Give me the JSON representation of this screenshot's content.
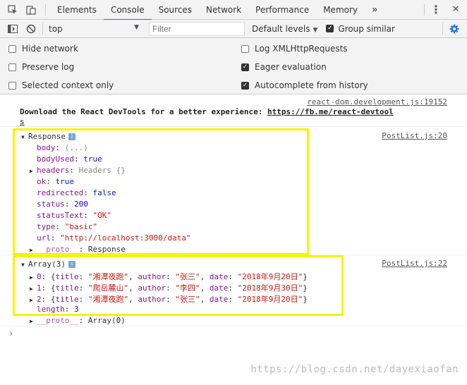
{
  "tabs": {
    "items": [
      "Elements",
      "Console",
      "Sources",
      "Network",
      "Performance",
      "Memory"
    ],
    "more": "»",
    "menu": "⋮",
    "close": "✕"
  },
  "toolbar": {
    "context": "top",
    "filter_placeholder": "Filter",
    "levels": "Default levels",
    "group_similar": "Group similar",
    "group_similar_checked": true
  },
  "settings": {
    "hide_network": "Hide network",
    "preserve_log": "Preserve log",
    "selected_context": "Selected context only",
    "log_xhr": "Log XMLHttpRequests",
    "eager_eval": "Eager evaluation",
    "autocomplete": "Autocomplete from history"
  },
  "console": {
    "react_source": "react-dom.development.js:19152",
    "react_msg": "Download the React DevTools for a better experience: ",
    "react_link_1": "https://fb.me/react-devtool",
    "react_link_2": "s",
    "response_source": "PostList.js:20",
    "response_title": "Response",
    "response_props": [
      {
        "key": "body",
        "value": "(...)",
        "type": "g"
      },
      {
        "key": "bodyUsed",
        "value": "true",
        "type": "b"
      },
      {
        "key": "headers",
        "value": "Headers {}",
        "type": "g",
        "expandable": true
      },
      {
        "key": "ok",
        "value": "true",
        "type": "b"
      },
      {
        "key": "redirected",
        "value": "false",
        "type": "b"
      },
      {
        "key": "status",
        "value": "200",
        "type": "n"
      },
      {
        "key": "statusText",
        "value": "\"OK\"",
        "type": "s"
      },
      {
        "key": "type",
        "value": "\"basic\"",
        "type": "s"
      },
      {
        "key": "url",
        "value": "\"http://localhost:3000/data\"",
        "type": "s"
      },
      {
        "key": "__proto__",
        "value": "Response",
        "type": "plain",
        "expandable": true
      }
    ],
    "array_source": "PostList.js:22",
    "array_title": "Array(3)",
    "array_items": [
      {
        "idx": "0",
        "title": "\"湘潭夜跑\"",
        "author": "\"张三\"",
        "date": "\"2018年9月20日\""
      },
      {
        "idx": "1",
        "title": "\"爬岳麓山\"",
        "author": "\"李四\"",
        "date": "\"2018年9月30日\""
      },
      {
        "idx": "2",
        "title": "\"湘潭夜跑\"",
        "author": "\"张三\"",
        "date": "\"2018年9月20日\""
      }
    ],
    "array_length_key": "length",
    "array_length": "3",
    "array_proto_key": "__proto__",
    "array_proto": "Array(0)",
    "prompt": "›"
  },
  "watermark": "https://blog.csdn.net/dayexiaofan",
  "colors": {
    "highlight": "#f5f500",
    "active_tab": "#1a73e8"
  }
}
